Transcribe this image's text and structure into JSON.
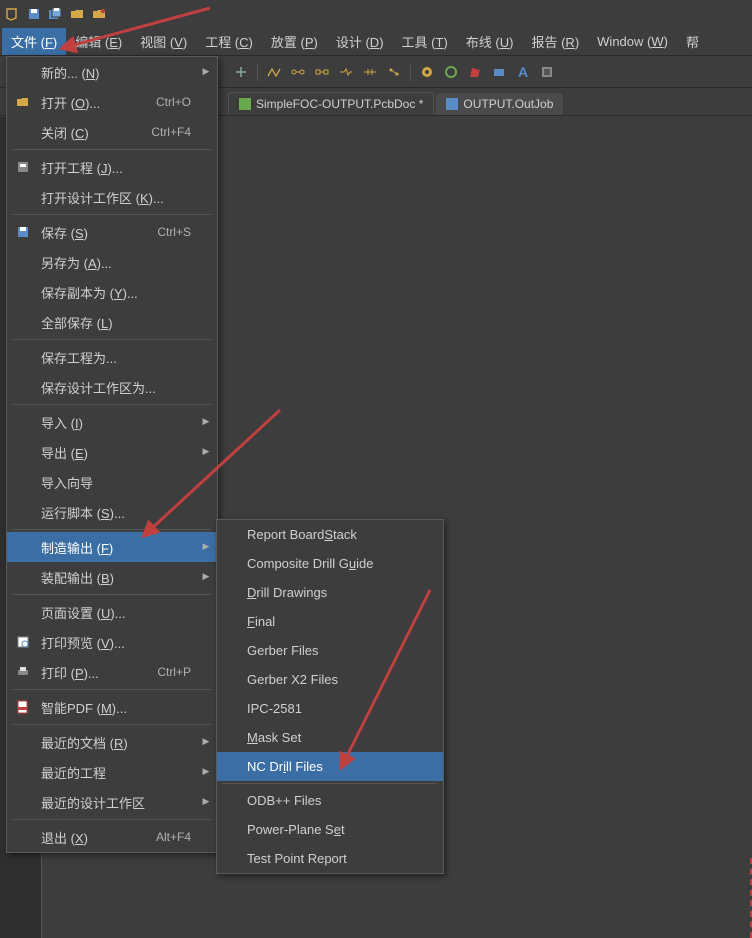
{
  "titlebar": {
    "icons": [
      "app-logo",
      "save-icon",
      "save-all-icon",
      "open-folder-icon",
      "open-project-icon"
    ]
  },
  "menubar": {
    "items": [
      {
        "label": "文件 (",
        "u": "F",
        "tail": ")",
        "active": true
      },
      {
        "label": "编辑 (",
        "u": "E",
        "tail": ")"
      },
      {
        "label": "视图 (",
        "u": "V",
        "tail": ")"
      },
      {
        "label": "工程 (",
        "u": "C",
        "tail": ")"
      },
      {
        "label": "放置 (",
        "u": "P",
        "tail": ")"
      },
      {
        "label": "设计 (",
        "u": "D",
        "tail": ")"
      },
      {
        "label": "工具 (",
        "u": "T",
        "tail": ")"
      },
      {
        "label": "布线 (",
        "u": "U",
        "tail": ")"
      },
      {
        "label": "报告 (",
        "u": "R",
        "tail": ")"
      },
      {
        "label": "Window (",
        "u": "W",
        "tail": ")"
      },
      {
        "label": "帮"
      }
    ]
  },
  "toolbar_right": {
    "text_a": "A"
  },
  "tabs": [
    {
      "label": "SimpleFOC-OUTPUT.PcbDoc *",
      "icon": "pcb-icon",
      "active": true
    },
    {
      "label": "OUTPUT.OutJob",
      "icon": "outjob-icon"
    }
  ],
  "file_menu": [
    {
      "type": "item",
      "icon": "",
      "label": "新的... (",
      "u": "N",
      "tail": ")",
      "shortcut": "",
      "arrow": true
    },
    {
      "type": "item",
      "icon": "open-icon",
      "label": "打开 (",
      "u": "O",
      "tail": ")...",
      "shortcut": "Ctrl+O"
    },
    {
      "type": "item",
      "icon": "",
      "label": "关闭 (",
      "u": "C",
      "tail": ")",
      "shortcut": "Ctrl+F4"
    },
    {
      "type": "sep"
    },
    {
      "type": "item",
      "icon": "project-icon",
      "label": "打开工程 (",
      "u": "J",
      "tail": ")..."
    },
    {
      "type": "item",
      "icon": "",
      "label": "打开设计工作区 (",
      "u": "K",
      "tail": ")..."
    },
    {
      "type": "sep"
    },
    {
      "type": "item",
      "icon": "save-icon",
      "label": "保存 (",
      "u": "S",
      "tail": ")",
      "shortcut": "Ctrl+S"
    },
    {
      "type": "item",
      "icon": "",
      "label": "另存为 (",
      "u": "A",
      "tail": ")..."
    },
    {
      "type": "item",
      "icon": "",
      "label": "保存副本为 (",
      "u": "Y",
      "tail": ")..."
    },
    {
      "type": "item",
      "icon": "",
      "label": "全部保存 (",
      "u": "L",
      "tail": ")"
    },
    {
      "type": "sep"
    },
    {
      "type": "item",
      "icon": "",
      "label": "保存工程为..."
    },
    {
      "type": "item",
      "icon": "",
      "label": "保存设计工作区为..."
    },
    {
      "type": "sep"
    },
    {
      "type": "item",
      "icon": "",
      "label": "导入 (",
      "u": "I",
      "tail": ")",
      "arrow": true
    },
    {
      "type": "item",
      "icon": "",
      "label": "导出 (",
      "u": "E",
      "tail": ")",
      "arrow": true
    },
    {
      "type": "item",
      "icon": "",
      "label": "导入向导"
    },
    {
      "type": "item",
      "icon": "",
      "label": "运行脚本 (",
      "u": "S",
      "tail": ")..."
    },
    {
      "type": "sep"
    },
    {
      "type": "item",
      "icon": "",
      "label": "制造输出 (",
      "u": "F",
      "tail": ")",
      "arrow": true,
      "hl": true
    },
    {
      "type": "item",
      "icon": "",
      "label": "装配输出 (",
      "u": "B",
      "tail": ")",
      "arrow": true
    },
    {
      "type": "sep"
    },
    {
      "type": "item",
      "icon": "",
      "label": "页面设置 (",
      "u": "U",
      "tail": ")..."
    },
    {
      "type": "item",
      "icon": "preview-icon",
      "label": "打印预览 (",
      "u": "V",
      "tail": ")..."
    },
    {
      "type": "item",
      "icon": "print-icon",
      "label": "打印 (",
      "u": "P",
      "tail": ")...",
      "shortcut": "Ctrl+P"
    },
    {
      "type": "sep"
    },
    {
      "type": "item",
      "icon": "pdf-icon",
      "label": "智能PDF (",
      "u": "M",
      "tail": ")..."
    },
    {
      "type": "sep"
    },
    {
      "type": "item",
      "icon": "",
      "label": "最近的文档 (",
      "u": "R",
      "tail": ")",
      "arrow": true
    },
    {
      "type": "item",
      "icon": "",
      "label": "最近的工程",
      "arrow": true
    },
    {
      "type": "item",
      "icon": "",
      "label": "最近的设计工作区",
      "arrow": true
    },
    {
      "type": "sep"
    },
    {
      "type": "item",
      "icon": "",
      "label": "退出 (",
      "u": "X",
      "tail": ")",
      "shortcut": "Alt+F4"
    }
  ],
  "submenu": [
    {
      "type": "item",
      "label": "Report Board ",
      "u": "S",
      "tail": "tack"
    },
    {
      "type": "item",
      "label": "Composite Drill G",
      "u": "u",
      "tail": "ide"
    },
    {
      "type": "item",
      "label": "",
      "u": "D",
      "tail": "rill Drawings"
    },
    {
      "type": "item",
      "label": "",
      "u": "F",
      "tail": "inal"
    },
    {
      "type": "item",
      "label": "Gerber Files"
    },
    {
      "type": "item",
      "label": "Gerber X2 Files"
    },
    {
      "type": "item",
      "label": "IPC-2581"
    },
    {
      "type": "item",
      "label": "",
      "u": "M",
      "tail": "ask Set"
    },
    {
      "type": "item",
      "label": "NC Dr",
      "u": "i",
      "tail": "ll Files",
      "hl": true
    },
    {
      "type": "sep"
    },
    {
      "type": "item",
      "label": "ODB++ Files"
    },
    {
      "type": "item",
      "label": "Power-Plane S",
      "u": "e",
      "tail": "t"
    },
    {
      "type": "item",
      "label": "Test Point Report"
    }
  ]
}
